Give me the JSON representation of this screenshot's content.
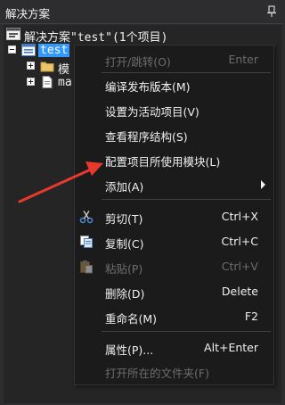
{
  "panel": {
    "title": "解决方案",
    "pin_icon": "pin-icon"
  },
  "tree": {
    "solution_label": "解决方案\"test\"(1个项目)",
    "project_label": "test",
    "folder_label": "模",
    "file_label": "ma"
  },
  "context_menu": {
    "items": [
      {
        "label": "打开/跳转(O)",
        "shortcut": "Enter",
        "disabled": true
      },
      {
        "label": "编译发布版本(M)",
        "shortcut": ""
      },
      {
        "label": "设置为活动项目(V)",
        "shortcut": ""
      },
      {
        "label": "查看程序结构(S)",
        "shortcut": ""
      },
      {
        "label": "配置项目所使用模块(L)",
        "shortcut": ""
      },
      {
        "label": "添加(A)",
        "shortcut": "",
        "submenu": true
      },
      {
        "label": "剪切(T)",
        "shortcut": "Ctrl+X",
        "icon": "scissors-icon"
      },
      {
        "label": "复制(C)",
        "shortcut": "Ctrl+C",
        "icon": "copy-icon"
      },
      {
        "label": "粘贴(P)",
        "shortcut": "Ctrl+V",
        "icon": "paste-icon",
        "disabled": true
      },
      {
        "label": "删除(D)",
        "shortcut": "Delete"
      },
      {
        "label": "重命名(M)",
        "shortcut": "F2"
      },
      {
        "label": "属性(P)...",
        "shortcut": "Alt+Enter"
      },
      {
        "label": "打开所在的文件夹(F)",
        "shortcut": "",
        "disabled": true
      }
    ]
  },
  "colors": {
    "background": "#2d2d30",
    "tree_background": "#252526",
    "menu_background": "#1b1b1c",
    "selection": "#3399ff",
    "annotation_arrow": "#e8392c"
  }
}
